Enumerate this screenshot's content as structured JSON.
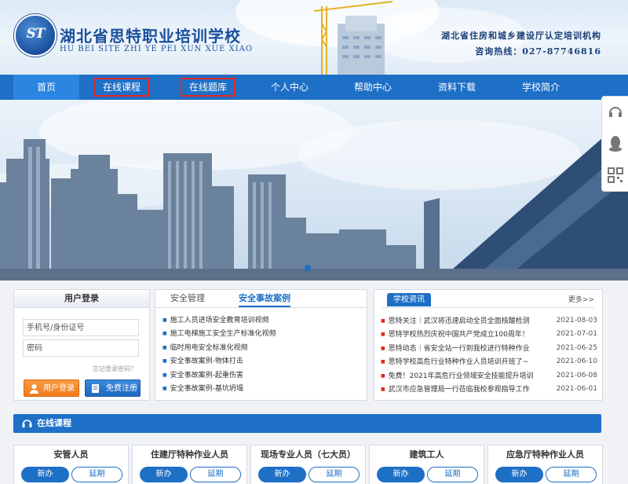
{
  "header": {
    "logo_text": "ST",
    "school_name": "湖北省思特职业培训学校",
    "school_pinyin": "HU BEI SITE ZHI YE PEI XUN XUE XIAO",
    "certification": "湖北省住房和城乡建设厅认定培训机构",
    "hotline": "咨询热线：027-87746816"
  },
  "nav": {
    "items": [
      {
        "label": "首页"
      },
      {
        "label": "在线课程"
      },
      {
        "label": "在线题库"
      },
      {
        "label": "个人中心"
      },
      {
        "label": "帮助中心"
      },
      {
        "label": "资料下载"
      },
      {
        "label": "学校简介"
      }
    ]
  },
  "side_tools": [
    "headset-icon",
    "qq-icon",
    "qr-code-icon"
  ],
  "login": {
    "title": "用户登录",
    "username_placeholder": "手机号/身份证号",
    "password_placeholder": "密码",
    "forgot": "忘记登录密码？",
    "login_button": "用户登录",
    "register_button": "免费注册"
  },
  "safety": {
    "tabs": [
      "安全管理",
      "安全事故案例"
    ],
    "items": [
      "施工人员进场安全教育培训视频",
      "施工电梯施工安全生产标准化视频",
      "临时用电安全标准化视频",
      "安全事故案例-物体打击",
      "安全事故案例-起重伤害",
      "安全事故案例-基坑坍塌"
    ]
  },
  "news": {
    "tag": "学校资讯",
    "more": "更多>>",
    "items": [
      {
        "title": "思特关注｜武汉将迅速启动全员全面核酸检测",
        "date": "2021-08-03"
      },
      {
        "title": "思特学校热烈庆祝中国共产党成立100周年！",
        "date": "2021-07-01"
      },
      {
        "title": "思特动态｜省安全站一行到我校进行特种作业",
        "date": "2021-06-25"
      },
      {
        "title": "思特学校高危行业特种作业人员培训开班了~",
        "date": "2021-06-10"
      },
      {
        "title": "免费！2021年高危行业领域安全技能提升培训",
        "date": "2021-06-08"
      },
      {
        "title": "武汉市应急管理局一行莅临我校参观指导工作",
        "date": "2021-06-01"
      }
    ]
  },
  "courses": {
    "section_title": "在线课程",
    "new_label": "新办",
    "extend_label": "延期",
    "cards": [
      {
        "title": "安管人员"
      },
      {
        "title": "住建厅特种作业人员"
      },
      {
        "title": "现场专业人员（七大员）"
      },
      {
        "title": "建筑工人"
      },
      {
        "title": "应急厅特种作业人员"
      }
    ]
  },
  "colors": {
    "primary": "#1e6fc6",
    "highlight_box": "#e4261e",
    "login_orange": "#f18522"
  }
}
